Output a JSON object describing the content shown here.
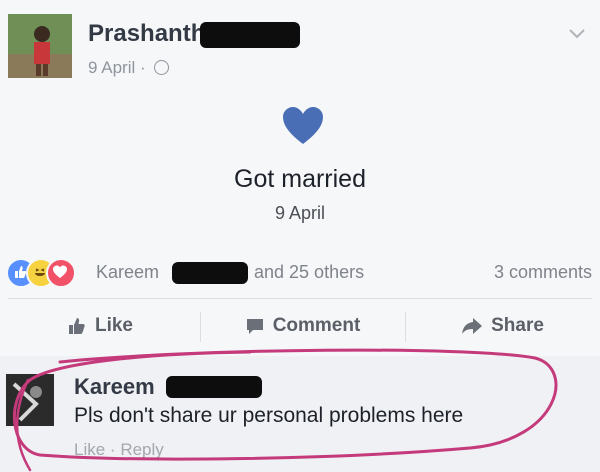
{
  "post": {
    "author": "Prashanth",
    "date": "9 April",
    "separator": "·"
  },
  "life_event": {
    "title": "Got married",
    "date": "9 April"
  },
  "reactions": {
    "names": "Kareem",
    "others": "and 25 others",
    "comments_count": "3 comments"
  },
  "actions": {
    "like": "Like",
    "comment": "Comment",
    "share": "Share"
  },
  "comment": {
    "author": "Kareem",
    "text": "Pls don't share ur personal problems here",
    "like": "Like",
    "separator": "·",
    "reply": "Reply"
  },
  "colors": {
    "heart": "#4a6eb5",
    "highlight_circle": "#c43a7b",
    "like_reaction": "#5890ff",
    "love_reaction": "#f25268",
    "haha_reaction": "#f7d240"
  }
}
